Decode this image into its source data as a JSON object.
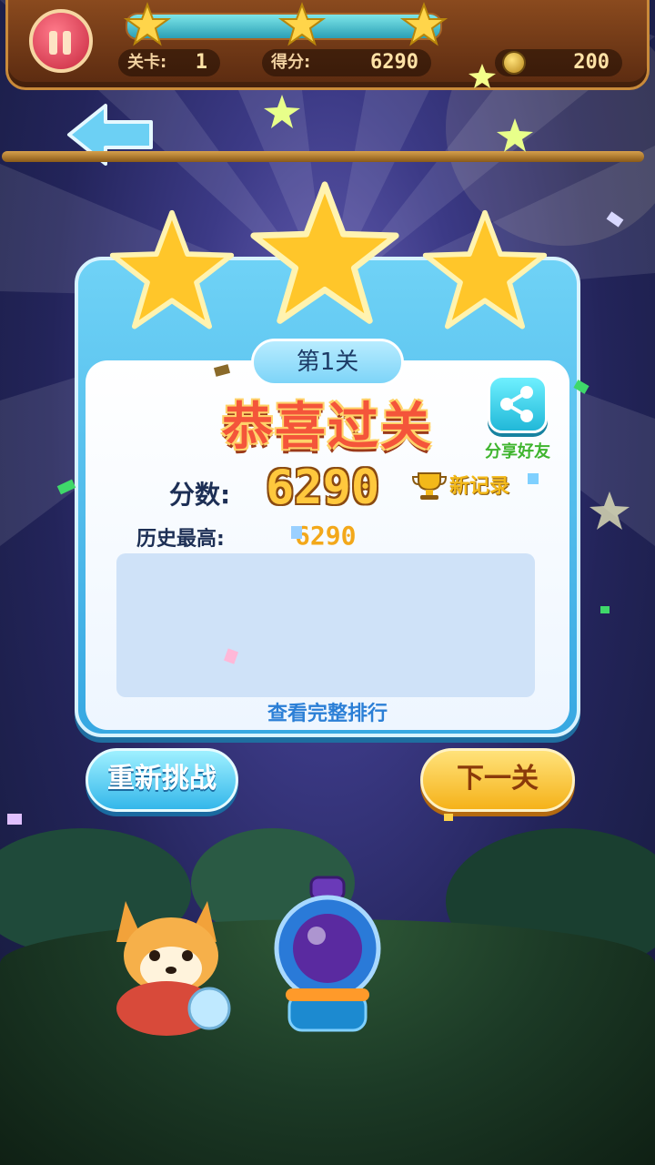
{
  "hud": {
    "level_label": "关卡:",
    "level_value": "1",
    "score_label": "得分:",
    "score_value": "6290",
    "coins_value": "200",
    "progress": 1.0,
    "stars_earned": 3
  },
  "dialog": {
    "level_pill": "第1关",
    "title": "恭喜过关",
    "share_label": "分享好友",
    "score_label": "分数:",
    "score_value": "6290",
    "new_record_label": "新记录",
    "best_label": "历史最高:",
    "best_value": "6290",
    "view_ranking_link": "查看完整排行",
    "stars_earned": 3
  },
  "buttons": {
    "retry": "重新挑战",
    "next": "下一关"
  },
  "colors": {
    "dialog_blue": "#37a8e2",
    "title_red": "#f4553a",
    "score_gold": "#ffc83d",
    "next_yellow": "#f5b21a",
    "retry_blue": "#34b7ea",
    "share_green": "#3fb52e"
  },
  "icons": [
    "pause-icon",
    "star-icon",
    "coin-icon",
    "back-arrow-icon",
    "share-icon",
    "trophy-icon"
  ]
}
